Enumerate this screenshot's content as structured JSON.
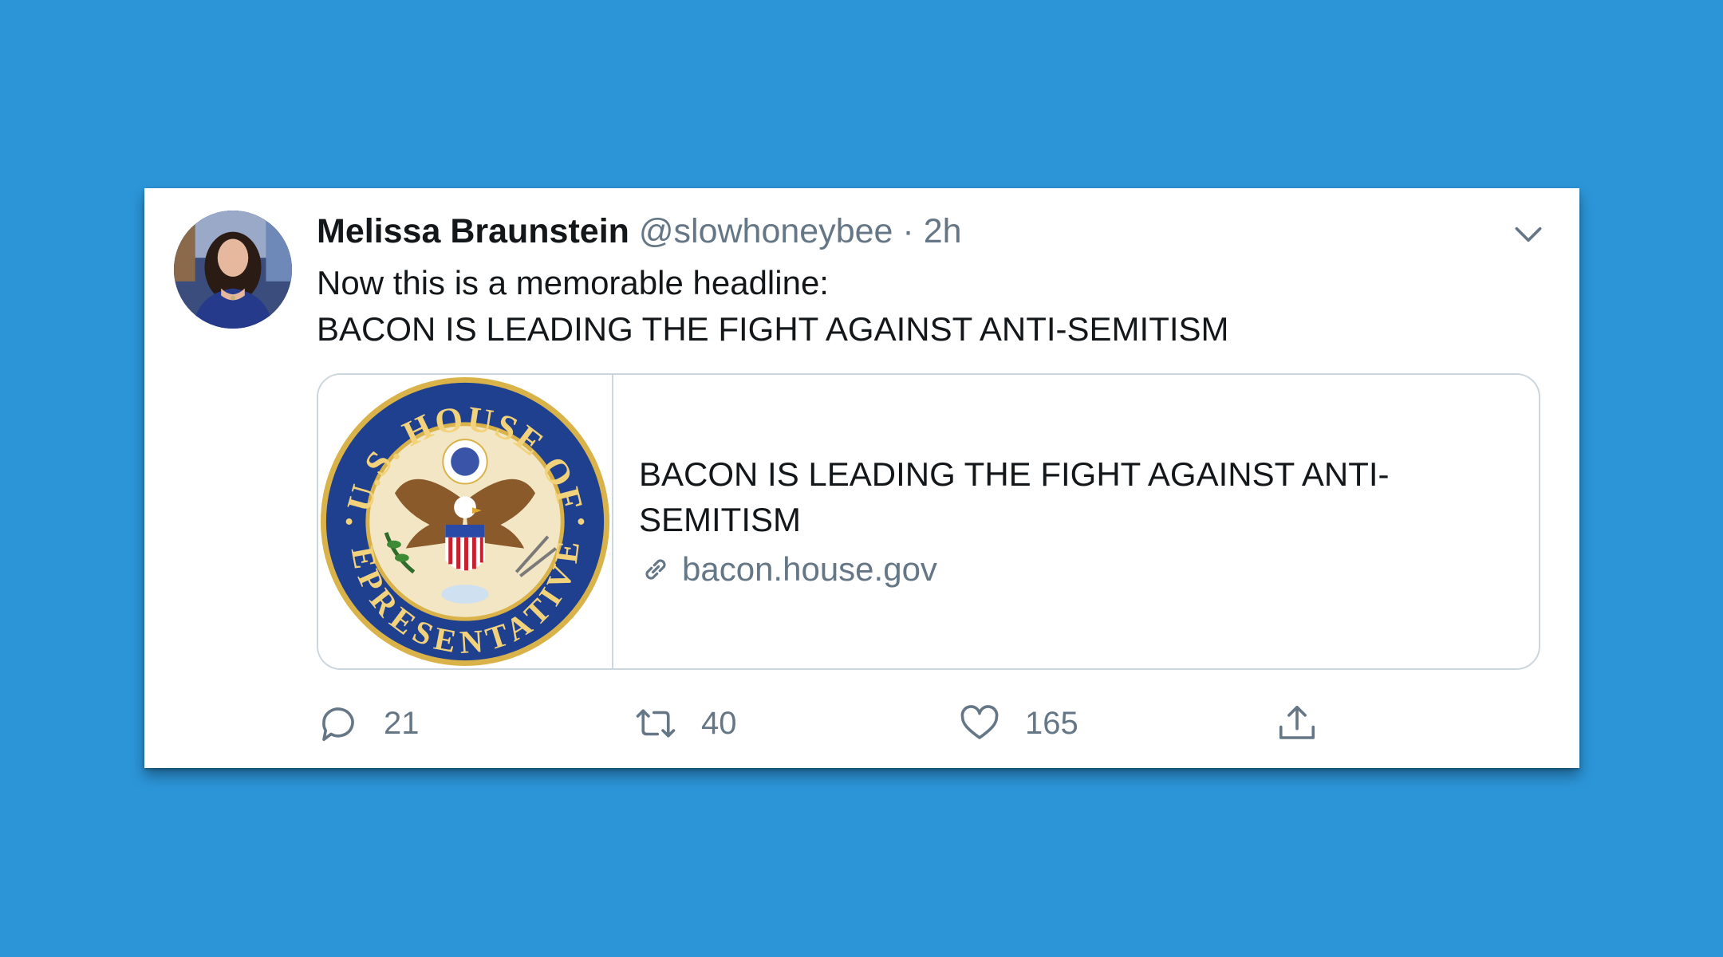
{
  "tweet": {
    "author_name": "Melissa Braunstein",
    "handle": "@slowhoneybee",
    "separator": "·",
    "time": "2h",
    "text_line1": "Now this is a memorable headline:",
    "text_line2": "BACON IS LEADING THE FIGHT AGAINST ANTI-SEMITISM"
  },
  "link_card": {
    "seal_text_top": "U.S. HOUSE OF",
    "seal_text_bottom": "REPRESENTATIVES",
    "title": "BACON IS LEADING THE FIGHT AGAINST ANTI-SEMITISM",
    "url": "bacon.house.gov"
  },
  "actions": {
    "reply_count": "21",
    "retweet_count": "40",
    "like_count": "165"
  },
  "icons": {
    "menu": "chevron-down-icon",
    "link": "link-icon",
    "reply": "reply-icon",
    "retweet": "retweet-icon",
    "like": "heart-icon",
    "share": "share-icon"
  },
  "colors": {
    "background": "#2c95d8",
    "text_primary": "#14171a",
    "text_secondary": "#657786",
    "border": "#ccd6dd",
    "seal_blue": "#1f3f8f",
    "seal_gold": "#d9b24a"
  }
}
